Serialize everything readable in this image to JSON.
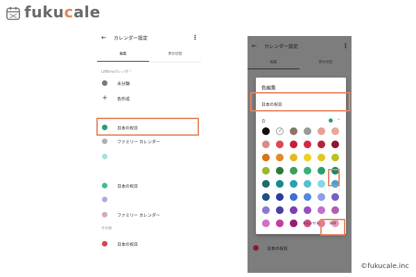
{
  "brand": {
    "logo_text_a": "fuku",
    "logo_text_b": "c",
    "logo_text_c": "ale",
    "accent": "#e08a5a",
    "highlight": "#e8835a"
  },
  "left_screen": {
    "back_icon": "arrow-left-icon",
    "title": "カレンダー設定",
    "tabs": [
      "編集",
      "表示切替"
    ],
    "section_header": "LINEmaカレンダー",
    "items": [
      {
        "label": "未分類",
        "color": "#7a7a7a"
      },
      {
        "label": "色作成",
        "icon": "plus-icon"
      },
      {
        "label": "日本の祝日",
        "color": "#2a9d74"
      },
      {
        "label": "ファミリー カレンダー",
        "color": "#b0b0b0"
      },
      {
        "label": "",
        "color": "#a8e0dc"
      },
      {
        "label": "日本の祝日",
        "color": "#3cc08c"
      },
      {
        "label": "",
        "color": "#b7a8e0"
      },
      {
        "label": "ファミリー カレンダー",
        "color": "#d6a8b6"
      }
    ],
    "section_other": "その他",
    "other_items": [
      {
        "label": "日本の祝日",
        "color": "#d9434a"
      }
    ]
  },
  "right_screen": {
    "title": "カレンダー設定",
    "tabs": [
      "編集",
      "表示切替"
    ],
    "dialog": {
      "title": "色編集",
      "input_value": "日本の祝日",
      "row_glyph": "合",
      "selected_color": "#2a9d74",
      "cancel": "キャンセル",
      "save": "保存",
      "palette": [
        [
          "#111111",
          "checked",
          "#8a7564",
          "#9a9a9a",
          "#e6a090",
          "#e8a89a"
        ],
        [
          "#d98a8a",
          "#d94a55",
          "#c41f3a",
          "#d22a48",
          "#b3233a",
          "#8a1a2a"
        ],
        [
          "#d9731a",
          "#e08a2a",
          "#e6b820",
          "#f0d020",
          "#e0c820",
          "#b7c423"
        ],
        [
          "#9ab830",
          "#2c7a3a",
          "#3f9e5a",
          "#3ab07a",
          "#27a068",
          "#1a8a70"
        ],
        [
          "#1f6a6a",
          "#1a8a8a",
          "#2a9fb0",
          "#56c0d0",
          "#89d4e8",
          "#3fa3d8"
        ],
        [
          "#1f4f8a",
          "#2a3f9e",
          "#3f6fd0",
          "#4f8ae0",
          "#8a9fe8",
          "#6f63c8"
        ],
        [
          "#8a79d0",
          "#4a3fa0",
          "#7a3fb0",
          "#9a4fc0",
          "#c070d0",
          "#b060b0"
        ],
        [
          "#d070c8",
          "#c03fa0",
          "#9a1a7a",
          "#d34a8a",
          "#e07aa8",
          "#e89ab8"
        ]
      ]
    },
    "bottom_item": {
      "label": "日本の祝日",
      "color": "#8a1a2a"
    }
  },
  "copyright": "©fukucale.inc"
}
